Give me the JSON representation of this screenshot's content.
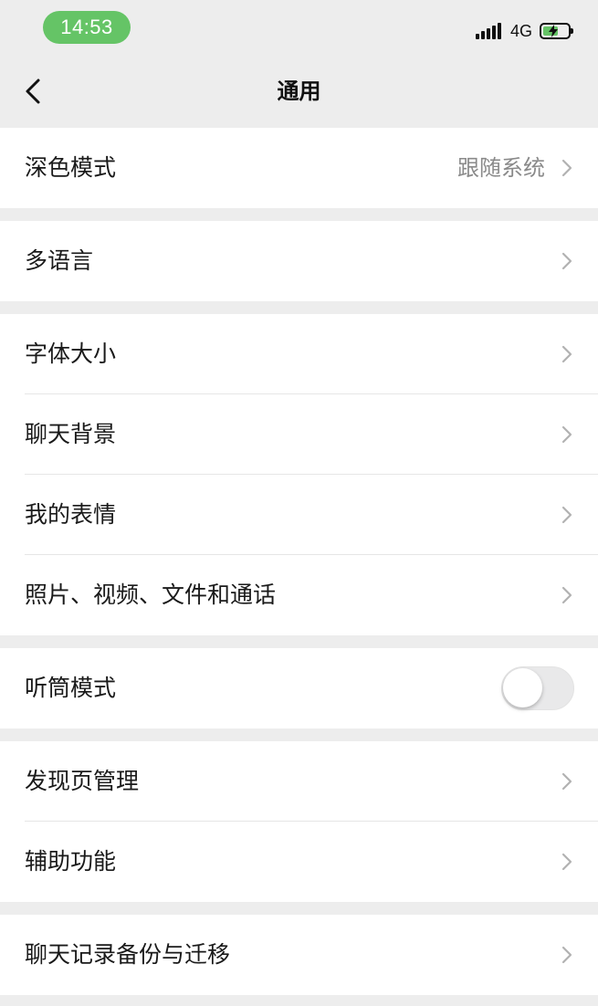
{
  "status_bar": {
    "time": "14:53",
    "network": "4G",
    "accent_color": "#65c466",
    "icons": [
      "signal-icon",
      "battery-charging-icon"
    ]
  },
  "nav": {
    "title": "通用",
    "back_icon": "chevron-left-icon"
  },
  "groups": [
    {
      "rows": [
        {
          "label": "深色模式",
          "value": "跟随系统",
          "type": "link"
        }
      ]
    },
    {
      "rows": [
        {
          "label": "多语言",
          "type": "link"
        }
      ]
    },
    {
      "rows": [
        {
          "label": "字体大小",
          "type": "link"
        },
        {
          "label": "聊天背景",
          "type": "link"
        },
        {
          "label": "我的表情",
          "type": "link"
        },
        {
          "label": "照片、视频、文件和通话",
          "type": "link"
        }
      ]
    },
    {
      "rows": [
        {
          "label": "听筒模式",
          "type": "toggle",
          "on": false
        }
      ]
    },
    {
      "rows": [
        {
          "label": "发现页管理",
          "type": "link"
        },
        {
          "label": "辅助功能",
          "type": "link"
        }
      ]
    },
    {
      "rows": [
        {
          "label": "聊天记录备份与迁移",
          "type": "link"
        }
      ]
    }
  ]
}
